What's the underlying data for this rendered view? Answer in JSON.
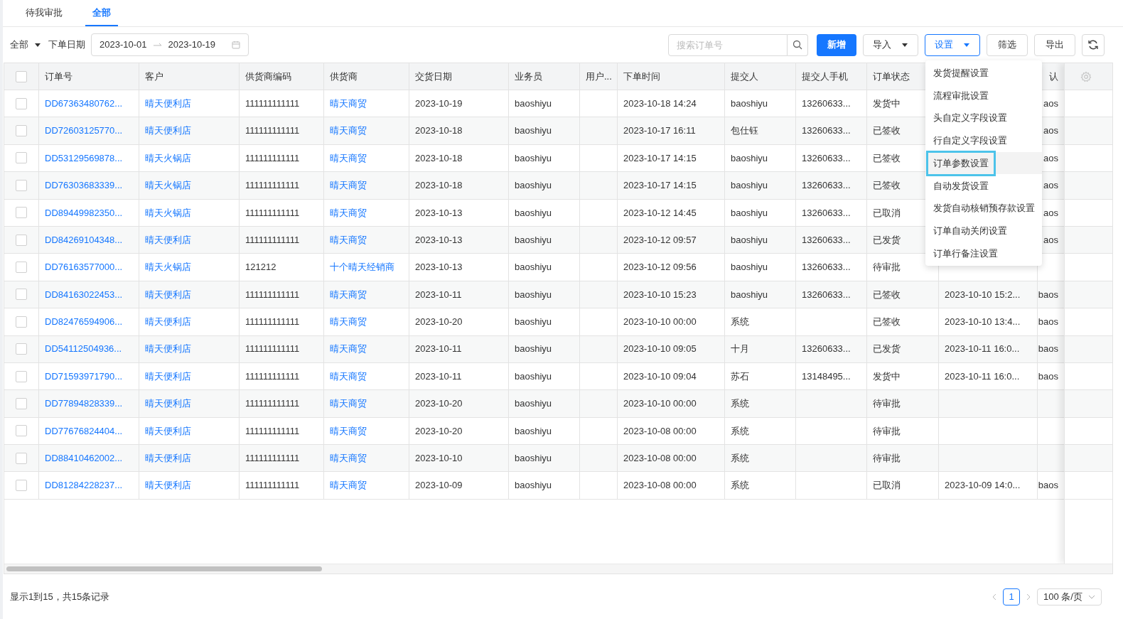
{
  "tabs": [
    {
      "label": "待我审批",
      "selected": false
    },
    {
      "label": "全部",
      "selected": true
    }
  ],
  "filters": {
    "scope": "全部",
    "date_label": "下单日期",
    "date_start": "2023-10-01",
    "date_end": "2023-10-19"
  },
  "search": {
    "placeholder": "搜索订单号"
  },
  "toolbar": [
    {
      "label": "新增",
      "kind": "primary"
    },
    {
      "label": "导入",
      "kind": "dropdown",
      "expanded": false
    },
    {
      "label": "设置",
      "kind": "dropdown",
      "expanded": true
    },
    {
      "label": "筛选",
      "kind": "plain"
    },
    {
      "label": "导出",
      "kind": "plain"
    }
  ],
  "settings_menu": [
    {
      "label": "发货提醒设置",
      "selected": false
    },
    {
      "label": "流程审批设置",
      "selected": false
    },
    {
      "label": "头自定义字段设置",
      "selected": false
    },
    {
      "label": "行自定义字段设置",
      "selected": false
    },
    {
      "label": "订单参数设置",
      "selected": true
    },
    {
      "label": "自动发货设置",
      "selected": false
    },
    {
      "label": "发货自动核销预存款设置",
      "selected": false
    },
    {
      "label": "订单自动关闭设置",
      "selected": false
    },
    {
      "label": "订单行备注设置",
      "selected": false
    }
  ],
  "table": {
    "select_all_checked": false,
    "columns": [
      {
        "label": "订单号",
        "kind": "link"
      },
      {
        "label": "客户",
        "kind": "link"
      },
      {
        "label": "供货商编码",
        "kind": "text"
      },
      {
        "label": "供货商",
        "kind": "link"
      },
      {
        "label": "交货日期",
        "kind": "text"
      },
      {
        "label": "业务员",
        "kind": "text"
      },
      {
        "label": "用户...",
        "kind": "text"
      },
      {
        "label": "下单时间",
        "kind": "text"
      },
      {
        "label": "提交人",
        "kind": "text"
      },
      {
        "label": "提交人手机",
        "kind": "text"
      },
      {
        "label": "订单状态",
        "kind": "text"
      },
      {
        "kind": "text"
      },
      {
        "label": "认",
        "kind": "clip"
      }
    ],
    "rows": [
      {
        "checked": false,
        "cells": [
          "DD67363480762...",
          "晴天便利店",
          "111111111111",
          "晴天商贸",
          "2023-10-19",
          "baoshiyu",
          "",
          "2023-10-18 14:24",
          "baoshiyu",
          "13260633...",
          "发货中",
          "",
          "aos"
        ]
      },
      {
        "checked": false,
        "cells": [
          "DD72603125770...",
          "晴天便利店",
          "111111111111",
          "晴天商贸",
          "2023-10-18",
          "baoshiyu",
          "",
          "2023-10-17 16:11",
          "包仕钰",
          "13260633...",
          "已签收",
          "",
          "aos"
        ]
      },
      {
        "checked": false,
        "cells": [
          "DD53129569878...",
          "晴天火锅店",
          "111111111111",
          "晴天商贸",
          "2023-10-18",
          "baoshiyu",
          "",
          "2023-10-17 14:15",
          "baoshiyu",
          "13260633...",
          "已签收",
          "",
          "aos"
        ]
      },
      {
        "checked": false,
        "cells": [
          "DD76303683339...",
          "晴天火锅店",
          "111111111111",
          "晴天商贸",
          "2023-10-18",
          "baoshiyu",
          "",
          "2023-10-17 14:15",
          "baoshiyu",
          "13260633...",
          "已签收",
          "",
          "aos"
        ]
      },
      {
        "checked": false,
        "cells": [
          "DD89449982350...",
          "晴天火锅店",
          "111111111111",
          "晴天商贸",
          "2023-10-13",
          "baoshiyu",
          "",
          "2023-10-12 14:45",
          "baoshiyu",
          "13260633...",
          "已取消",
          "",
          "aos"
        ]
      },
      {
        "checked": false,
        "cells": [
          "DD84269104348...",
          "晴天便利店",
          "111111111111",
          "晴天商贸",
          "2023-10-13",
          "baoshiyu",
          "",
          "2023-10-12 09:57",
          "baoshiyu",
          "13260633...",
          "已发货",
          "",
          "aos"
        ]
      },
      {
        "checked": false,
        "cells": [
          "DD76163577000...",
          "晴天火锅店",
          "121212",
          "十个晴天经销商",
          "2023-10-13",
          "baoshiyu",
          "",
          "2023-10-12 09:56",
          "baoshiyu",
          "13260633...",
          "待审批",
          "",
          ""
        ]
      },
      {
        "checked": false,
        "cells": [
          "DD84163022453...",
          "晴天便利店",
          "111111111111",
          "晴天商贸",
          "2023-10-11",
          "baoshiyu",
          "",
          "2023-10-10 15:23",
          "baoshiyu",
          "13260633...",
          "已签收",
          "2023-10-10 15:2...",
          "baos"
        ]
      },
      {
        "checked": false,
        "cells": [
          "DD82476594906...",
          "晴天便利店",
          "111111111111",
          "晴天商贸",
          "2023-10-20",
          "baoshiyu",
          "",
          "2023-10-10 00:00",
          "系统",
          "",
          "已签收",
          "2023-10-10 13:4...",
          "baos"
        ]
      },
      {
        "checked": false,
        "cells": [
          "DD54112504936...",
          "晴天便利店",
          "111111111111",
          "晴天商贸",
          "2023-10-11",
          "baoshiyu",
          "",
          "2023-10-10 09:05",
          "十月",
          "13260633...",
          "已发货",
          "2023-10-11 16:0...",
          "baos"
        ]
      },
      {
        "checked": false,
        "cells": [
          "DD71593971790...",
          "晴天便利店",
          "111111111111",
          "晴天商贸",
          "2023-10-11",
          "baoshiyu",
          "",
          "2023-10-10 09:04",
          "苏石",
          "13148495...",
          "发货中",
          "2023-10-11 16:0...",
          "baos"
        ]
      },
      {
        "checked": false,
        "cells": [
          "DD77894828339...",
          "晴天便利店",
          "111111111111",
          "晴天商贸",
          "2023-10-20",
          "baoshiyu",
          "",
          "2023-10-10 00:00",
          "系统",
          "",
          "待审批",
          "",
          ""
        ]
      },
      {
        "checked": false,
        "cells": [
          "DD77676824404...",
          "晴天便利店",
          "111111111111",
          "晴天商贸",
          "2023-10-20",
          "baoshiyu",
          "",
          "2023-10-08 00:00",
          "系统",
          "",
          "待审批",
          "",
          ""
        ]
      },
      {
        "checked": false,
        "cells": [
          "DD88410462002...",
          "晴天便利店",
          "111111111111",
          "晴天商贸",
          "2023-10-10",
          "baoshiyu",
          "",
          "2023-10-08 00:00",
          "系统",
          "",
          "待审批",
          "",
          ""
        ]
      },
      {
        "checked": false,
        "cells": [
          "DD81284228237...",
          "晴天便利店",
          "111111111111",
          "晴天商贸",
          "2023-10-09",
          "baoshiyu",
          "",
          "2023-10-08 00:00",
          "系统",
          "",
          "已取消",
          "2023-10-09 14:0...",
          "baos"
        ]
      }
    ]
  },
  "footer": {
    "summary": "显示1到15，共15条记录",
    "pages": [
      {
        "label": "1",
        "selected": true
      }
    ],
    "page_size": "100 条/页"
  }
}
